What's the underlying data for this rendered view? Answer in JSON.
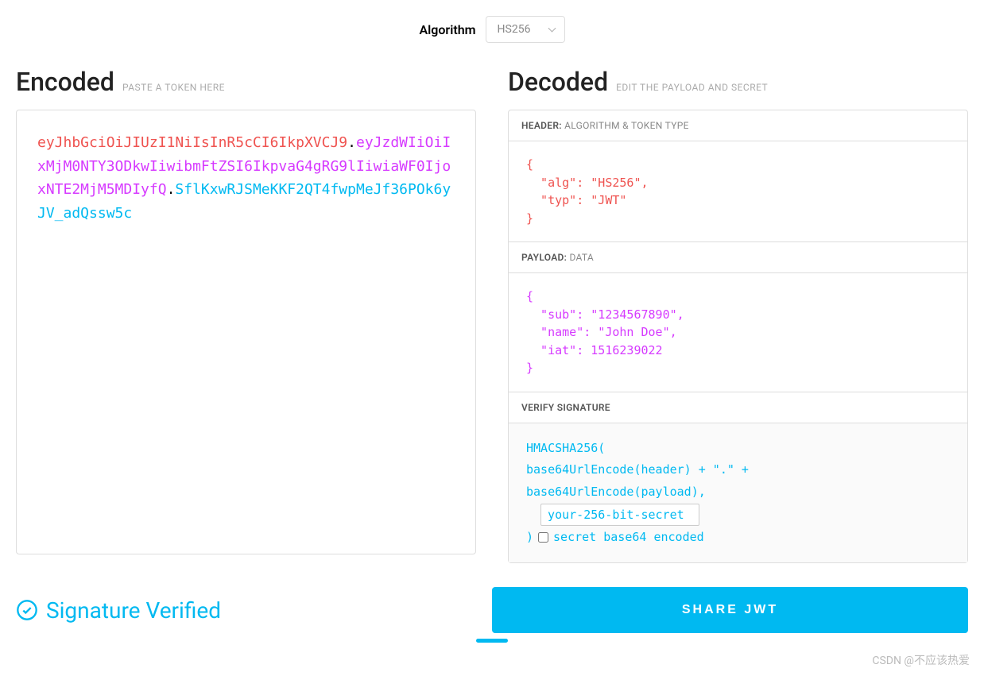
{
  "algorithm": {
    "label": "Algorithm",
    "selected": "HS256"
  },
  "encoded": {
    "title": "Encoded",
    "subtitle": "PASTE A TOKEN HERE",
    "header_part": "eyJhbGciOiJIUzI1NiIsInR5cCI6IkpXVCJ9",
    "payload_part": "eyJzdWIiOiIxMjM0NTY3ODkwIiwibmFtZSI6IkpvaG4gRG9lIiwiaWF0IjoxNTE2MjM5MDIyfQ",
    "signature_part": "SflKxwRJSMeKKF2QT4fwpMeJf36POk6yJV_adQssw5c"
  },
  "decoded": {
    "title": "Decoded",
    "subtitle": "EDIT THE PAYLOAD AND SECRET",
    "header_label": "HEADER:",
    "header_sub": "ALGORITHM & TOKEN TYPE",
    "header_json": "{\n  \"alg\": \"HS256\",\n  \"typ\": \"JWT\"\n}",
    "payload_label": "PAYLOAD:",
    "payload_sub": "DATA",
    "payload_json": "{\n  \"sub\": \"1234567890\",\n  \"name\": \"John Doe\",\n  \"iat\": 1516239022\n}",
    "sig_label": "VERIFY SIGNATURE",
    "sig_line1": "HMACSHA256(",
    "sig_line2": "  base64UrlEncode(header) + \".\" +",
    "sig_line3": "  base64UrlEncode(payload),",
    "sig_line4_close": ")",
    "sig_checkbox_label": "secret base64 encoded",
    "secret_value": "your-256-bit-secret"
  },
  "status": {
    "verified_text": "Signature Verified",
    "share_label": "SHARE JWT"
  },
  "watermark": "CSDN @不应该热爱"
}
